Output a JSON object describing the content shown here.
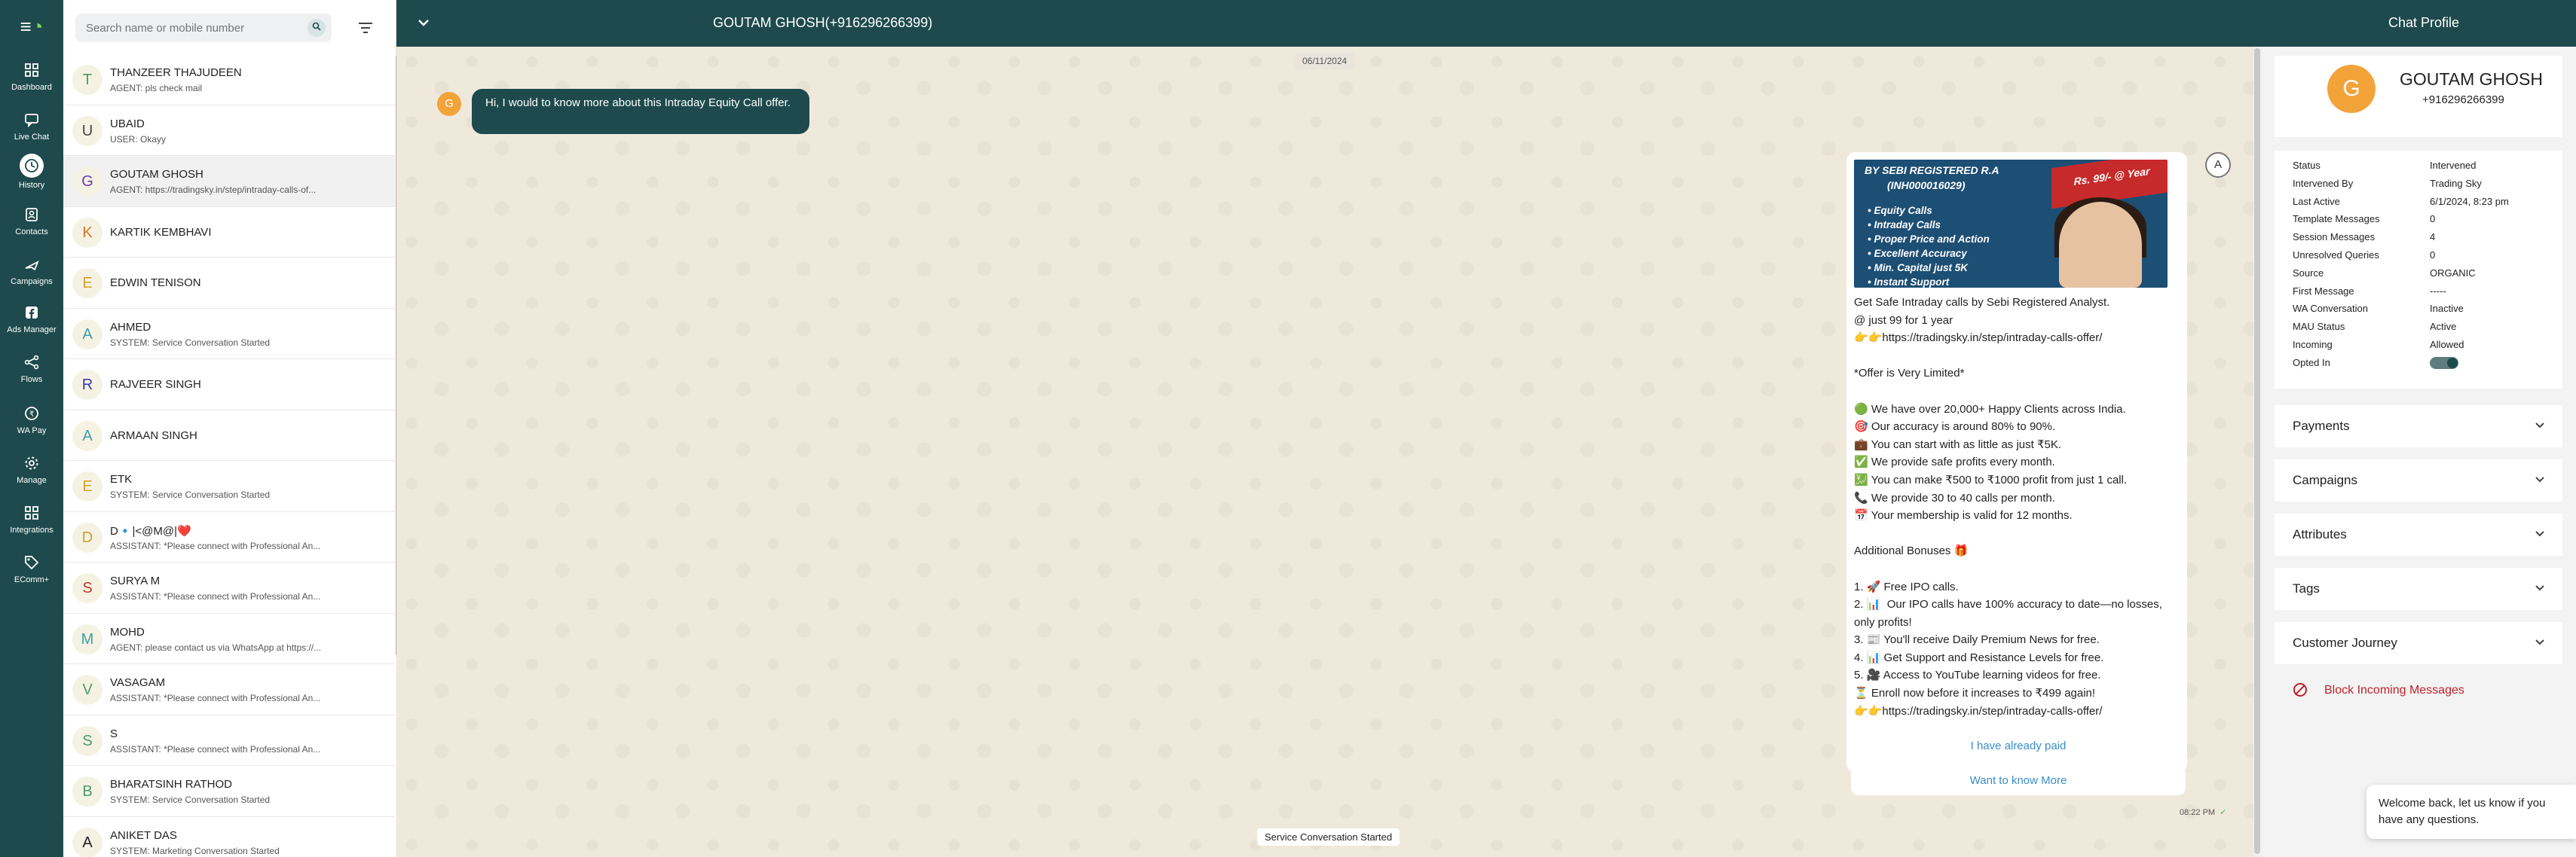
{
  "nav": {
    "items": [
      {
        "label": "Dashboard",
        "icon": "dashboard-icon"
      },
      {
        "label": "Live Chat",
        "icon": "chat-icon"
      },
      {
        "label": "History",
        "icon": "history-icon"
      },
      {
        "label": "Contacts",
        "icon": "contacts-icon"
      },
      {
        "label": "Campaigns",
        "icon": "campaigns-icon"
      },
      {
        "label": "Ads Manager",
        "icon": "facebook-icon"
      },
      {
        "label": "Flows",
        "icon": "flows-icon"
      },
      {
        "label": "WA Pay",
        "icon": "wapay-icon"
      },
      {
        "label": "Manage",
        "icon": "gear-icon"
      },
      {
        "label": "Integrations",
        "icon": "integrations-icon"
      },
      {
        "label": "EComm+",
        "icon": "tag-icon"
      }
    ],
    "active_index": 2
  },
  "list": {
    "search_placeholder": "Search name or mobile number",
    "contacts": [
      {
        "initial": "T",
        "name": "THANZEER THAJUDEEN",
        "sub": "AGENT: pls check mail",
        "color": "#4a9c6a"
      },
      {
        "initial": "U",
        "name": "UBAID",
        "sub": "USER: Okayy",
        "color": "#444444"
      },
      {
        "initial": "G",
        "name": "GOUTAM GHOSH",
        "sub": "AGENT: https://tradingsky.in/step/intraday-calls-of...",
        "color": "#6a3ab0"
      },
      {
        "initial": "K",
        "name": "KARTIK KEMBHAVI",
        "sub": "",
        "color": "#d9752b"
      },
      {
        "initial": "E",
        "name": "EDWIN TENISON",
        "sub": "",
        "color": "#d9a12b"
      },
      {
        "initial": "A",
        "name": "AHMED",
        "sub": "SYSTEM: Service Conversation Started",
        "color": "#3aa0a8"
      },
      {
        "initial": "R",
        "name": "RAJVEER SINGH",
        "sub": "",
        "color": "#3a3ab0"
      },
      {
        "initial": "A",
        "name": "ARMAAN SINGH",
        "sub": "",
        "color": "#3aa0a8"
      },
      {
        "initial": "E",
        "name": "ETK",
        "sub": "SYSTEM: Service Conversation Started",
        "color": "#d9a12b"
      },
      {
        "initial": "D",
        "name": "D🔹|<@M@|❤️",
        "sub": "ASSISTANT: *Please connect with Professional An...",
        "color": "#c9a030"
      },
      {
        "initial": "S",
        "name": "SURYA M",
        "sub": "ASSISTANT: *Please connect with Professional An...",
        "color": "#c0392b"
      },
      {
        "initial": "M",
        "name": "MOHD",
        "sub": "AGENT: please contact us via WhatsApp at https://...",
        "color": "#3aa0a8"
      },
      {
        "initial": "V",
        "name": "VASAGAM",
        "sub": "ASSISTANT: *Please connect with Professional An...",
        "color": "#4a9c6a"
      },
      {
        "initial": "S",
        "name": "S",
        "sub": "ASSISTANT: *Please connect with Professional An...",
        "color": "#4a9c6a"
      },
      {
        "initial": "B",
        "name": "BHARATSINH RATHOD",
        "sub": "SYSTEM: Service Conversation Started",
        "color": "#4a9c6a"
      },
      {
        "initial": "A",
        "name": "ANIKET DAS",
        "sub": "SYSTEM: Marketing Conversation Started",
        "color": "#222222"
      }
    ],
    "selected_index": 2
  },
  "chat": {
    "title": "GOUTAM GHOSH(+916296266399)",
    "date": "06/11/2024",
    "incoming": {
      "avatar": "G",
      "text": "Hi, I would to know more about this Intraday Equity Call offer."
    },
    "outgoing": {
      "avatar": "A",
      "banner": {
        "line1": "BY SEBI REGISTERED R.A",
        "line2": "(INH000016029)",
        "price": "Rs. 99/- @ Year",
        "bullets": [
          "Equity Calls",
          "Intraday Calls",
          "Proper Price and Action",
          "Excellent Accuracy",
          "Min. Capital just 5K",
          "Instant Support"
        ]
      },
      "body": "Get Safe Intraday calls by Sebi Registered Analyst.\n@ just 99 for 1 year\n👉👉https://tradingsky.in/step/intraday-calls-offer/\n\n*Offer is Very Limited*\n\n🟢 We have over 20,000+ Happy Clients across India.\n🎯 Our accuracy is around 80% to 90%.\n💼 You can start with as little as just ₹5K.\n✅ We provide safe profits every month.\n💹 You can make ₹500 to ₹1000 profit from just 1 call.\n📞 We provide 30 to 40 calls per month.\n📅 Your membership is valid for 12 months.\n\nAdditional Bonuses 🎁\n\n1. 🚀 Free IPO calls.\n2. 📊  Our IPO calls have 100% accuracy to date—no losses, only profits!\n3. 📰 You'll receive Daily Premium News for free.\n4. 📊 Get Support and Resistance Levels for free.\n5. 🎥 Access to YouTube learning videos for free.\n⏳ Enroll now before it increases to ₹499 again!\n👉👉https://tradingsky.in/step/intraday-calls-offer/",
      "buttons": [
        "I have already paid",
        "Want to know More"
      ],
      "time": "08:22 PM"
    },
    "system_notice": "Service Conversation Started"
  },
  "profile": {
    "header": "Chat Profile",
    "avatar": "G",
    "name": "GOUTAM GHOSH",
    "phone": "+916296266399",
    "fields": [
      {
        "key": "Status",
        "value": "Intervened"
      },
      {
        "key": "Intervened By",
        "value": "Trading Sky"
      },
      {
        "key": "Last Active",
        "value": "6/1/2024, 8:23 pm"
      },
      {
        "key": "Template Messages",
        "value": "0"
      },
      {
        "key": "Session Messages",
        "value": "4"
      },
      {
        "key": "Unresolved Queries",
        "value": "0"
      },
      {
        "key": "Source",
        "value": "ORGANIC"
      },
      {
        "key": "First Message",
        "value": "-----"
      },
      {
        "key": "WA Conversation",
        "value": "Inactive"
      },
      {
        "key": "MAU Status",
        "value": "Active"
      },
      {
        "key": "Incoming",
        "value": "Allowed"
      },
      {
        "key": "Opted In",
        "value": ""
      }
    ],
    "opted_in": true,
    "sections": [
      "Payments",
      "Campaigns",
      "Attributes",
      "Tags",
      "Customer Journey"
    ],
    "block_label": "Block Incoming Messages"
  },
  "toast": {
    "text": "Welcome back, let us know if you have any questions."
  },
  "colors": {
    "primary": "#1e4a4d",
    "accent_avatar": "#f2a33a",
    "link": "#3a8ec9",
    "danger": "#c0222b"
  }
}
